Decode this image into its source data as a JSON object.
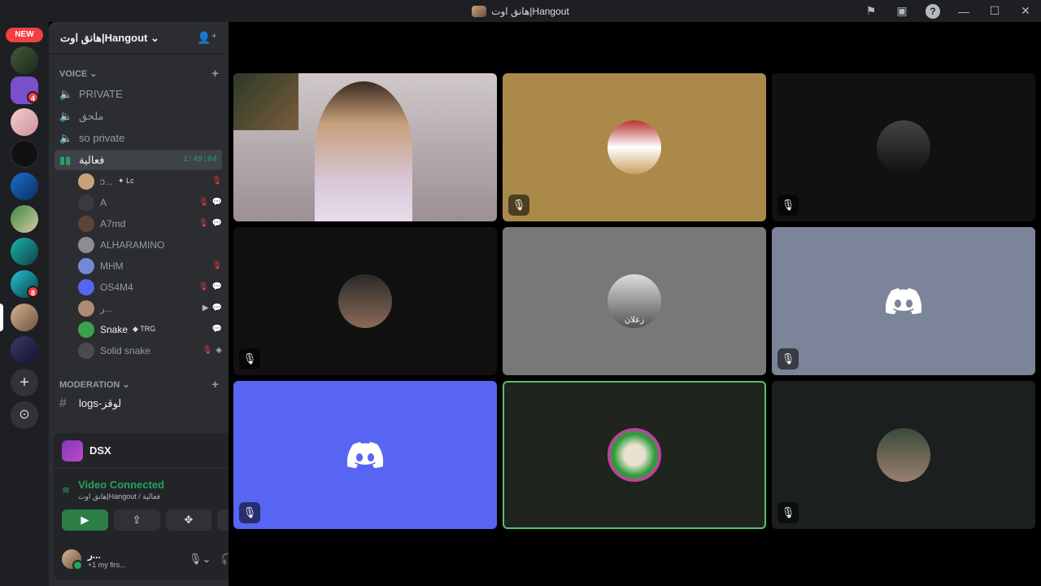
{
  "window": {
    "title": "هانق اوت|Hangout"
  },
  "rail": {
    "new_badge": "NEW",
    "badges": [
      "4",
      "8"
    ]
  },
  "server": {
    "name": "هانق اوت|Hangout"
  },
  "categories": {
    "voice": "VOICE",
    "moderation": "MODERATION"
  },
  "channels": [
    {
      "name": "PRIVATE"
    },
    {
      "name": "ملحق"
    },
    {
      "name": "so private"
    },
    {
      "name": "فعالية",
      "timer": "1:49:04"
    }
  ],
  "voice_users": [
    {
      "name": "ↄ...",
      "tag": "Lc",
      "color": "#c9a27a"
    },
    {
      "name": "A",
      "color": "#3a3b3f"
    },
    {
      "name": "A7md",
      "color": "#5b4636"
    },
    {
      "name": "ALHARAMINO",
      "color": "#8b8d92"
    },
    {
      "name": "MHM",
      "color": "#7289da"
    },
    {
      "name": "OS4M4",
      "color": "#5865f2"
    },
    {
      "name": "ر...",
      "color": "#b08a70"
    },
    {
      "name": "Snake",
      "tag": "TRG",
      "color": "#3aa34a"
    },
    {
      "name": "Solid snake",
      "color": "#4a4b4f"
    }
  ],
  "moderation_channels": [
    {
      "name": "logs-لوقز"
    }
  ],
  "panel": {
    "name": "DSX",
    "connection_status": "Video Connected",
    "connection_location": "هانق اوت|Hangout / فعالية",
    "account_name": "ر...",
    "account_status_count": "+1",
    "account_status": "my firs..."
  },
  "tiles": [
    {
      "kind": "video",
      "muted": false
    },
    {
      "kind": "avatar",
      "bg": "#ab8a49",
      "muted": true
    },
    {
      "kind": "avatar",
      "bg": "#111111",
      "muted": true
    },
    {
      "kind": "avatar",
      "bg": "#111111",
      "muted": true
    },
    {
      "kind": "avatar",
      "bg": "#787878",
      "caption": "زعلان",
      "muted": false
    },
    {
      "kind": "discord",
      "bg": "#7c8499",
      "muted": true
    },
    {
      "kind": "discord",
      "bg": "#5865f2",
      "muted": true
    },
    {
      "kind": "avatar",
      "bg": "#1f241f",
      "speaking": true,
      "muted": false
    },
    {
      "kind": "avatar",
      "bg": "#1b1f1e",
      "muted": true
    }
  ],
  "colors": {
    "accent_green": "#23a55a",
    "danger_red": "#f23f43",
    "blurple": "#5865f2"
  }
}
